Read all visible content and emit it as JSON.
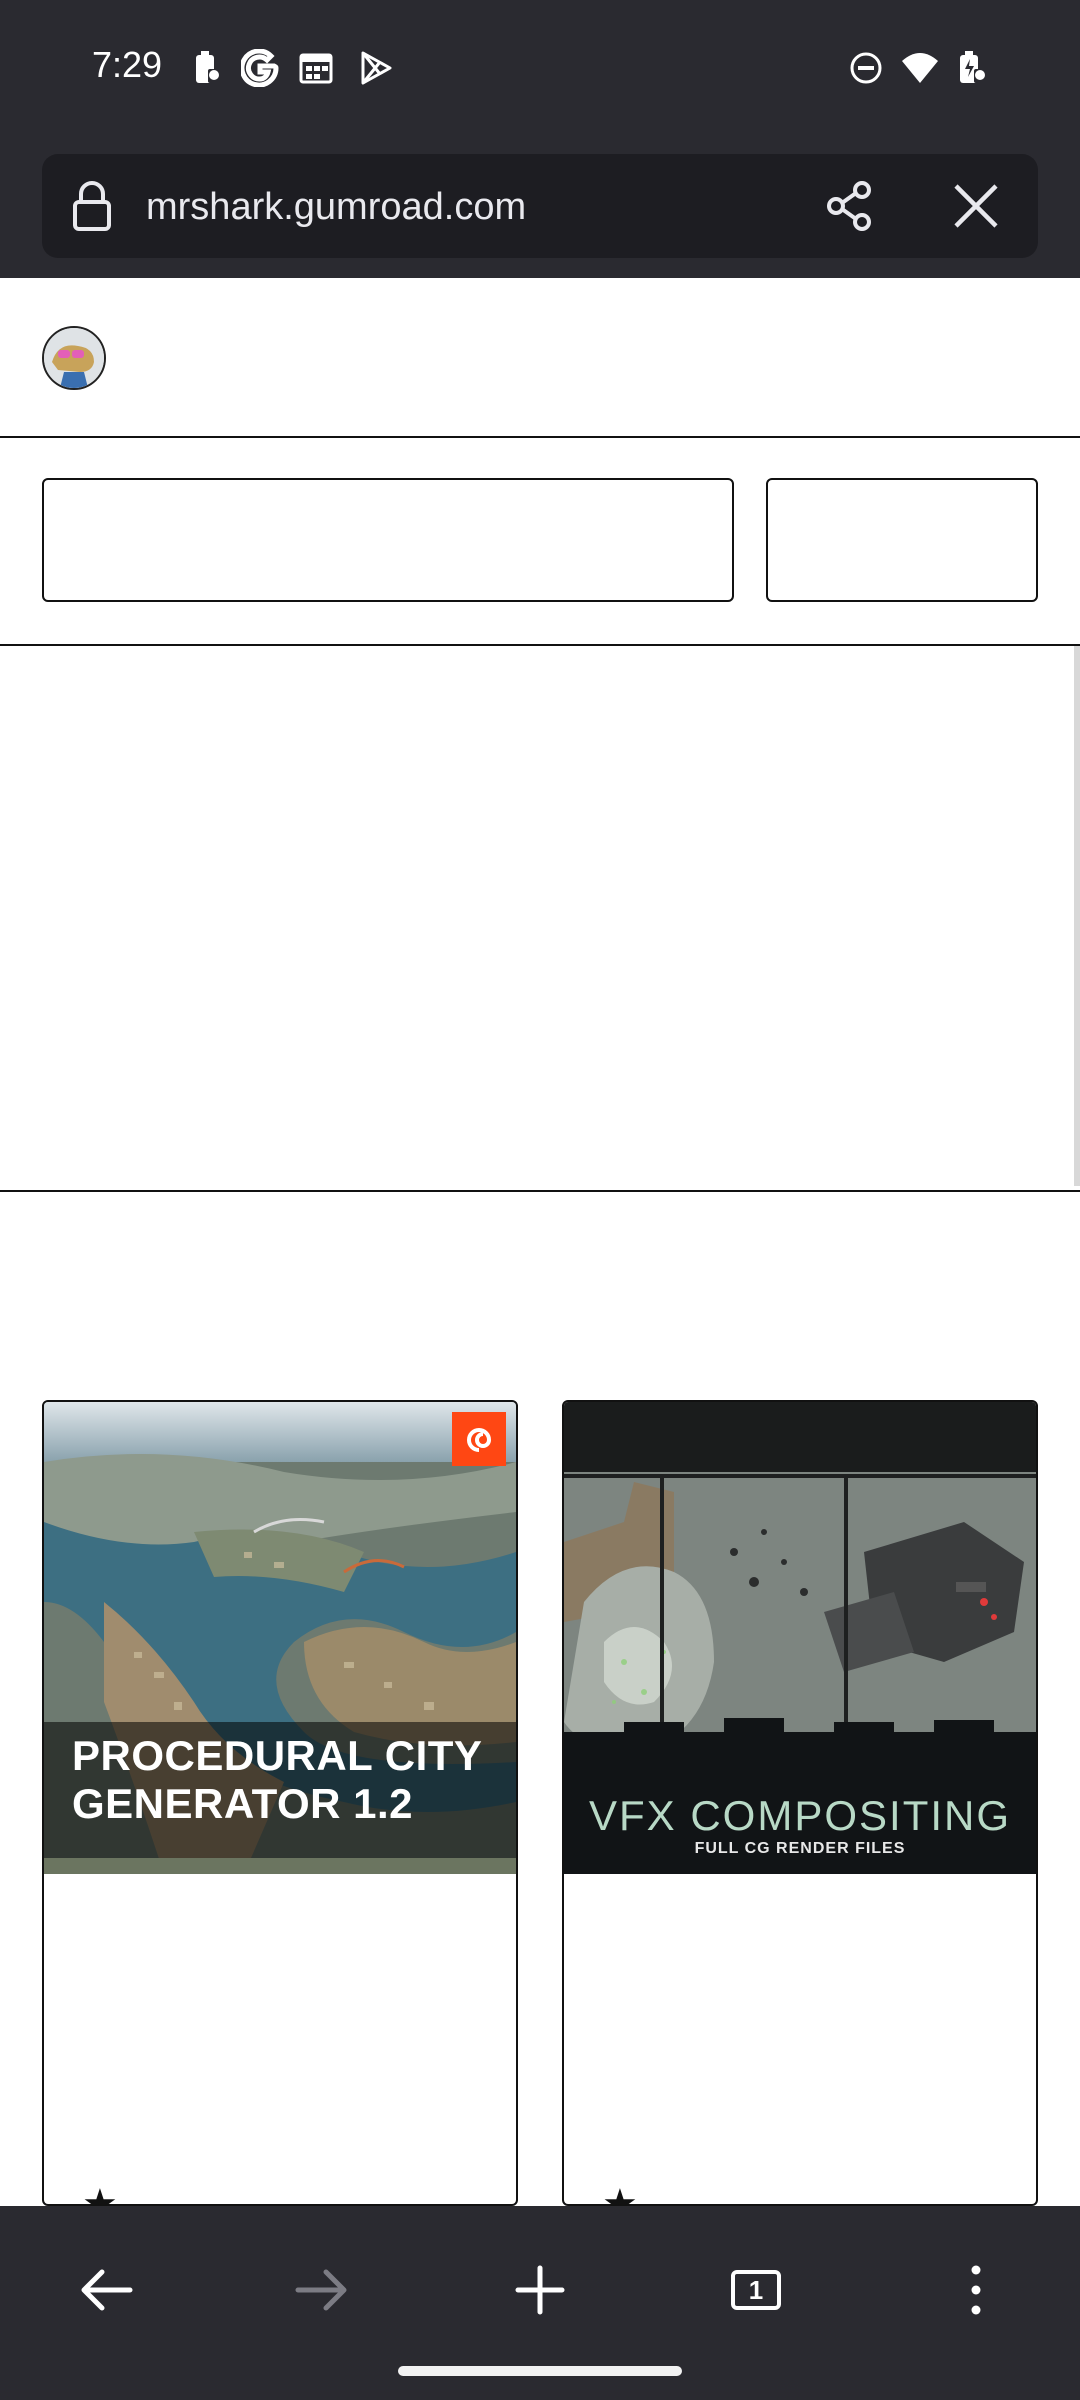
{
  "status_bar": {
    "time": "7:29",
    "left_icons": [
      "battery-saver-icon",
      "google-icon",
      "calendar-icon",
      "play-store-icon"
    ],
    "right_icons": [
      "do-not-disturb-icon",
      "wifi-icon",
      "battery-charging-icon"
    ]
  },
  "browser": {
    "url": "mrshark.gumroad.com",
    "icons": [
      "lock-icon",
      "share-icon",
      "close-icon"
    ]
  },
  "products": [
    {
      "title_line1": "PROCEDURAL CITY",
      "title_line2": "GENERATOR 1.2",
      "badge": "houdini-logo"
    },
    {
      "title": "VFX COMPOSITING",
      "subtitle": "FULL CG RENDER FILES"
    }
  ],
  "bottom_nav": {
    "tab_count": "1",
    "icons": [
      "back-arrow-icon",
      "forward-arrow-icon",
      "new-tab-icon",
      "tabs-icon",
      "more-icon"
    ]
  },
  "colors": {
    "chrome_bg": "#2a2a30",
    "url_field_bg": "#1d1d22",
    "page_bg": "#ffffff",
    "houdini_orange": "#ff4713"
  }
}
